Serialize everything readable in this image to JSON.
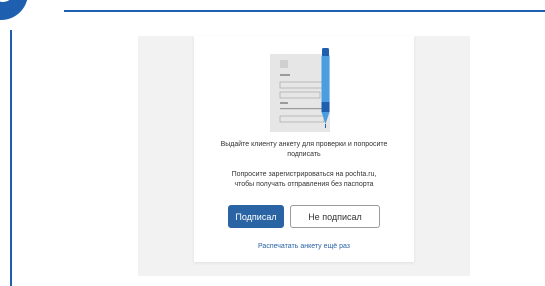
{
  "message": {
    "line1": "Выдайте клиенту анкету для проверки и попросите",
    "line2": "подписать"
  },
  "hint": {
    "line1": "Попросите зарегистрироваться на pochta.ru,",
    "line2": "чтобы получать отправления без паспорта"
  },
  "buttons": {
    "signed": "Подписал",
    "not_signed": "Не подписал"
  },
  "reprint_link": "Распечатать анкету ещё раз",
  "colors": {
    "brand": "#1f5fb0",
    "button_primary": "#2a64a5",
    "panel": "#f2f2f2"
  }
}
